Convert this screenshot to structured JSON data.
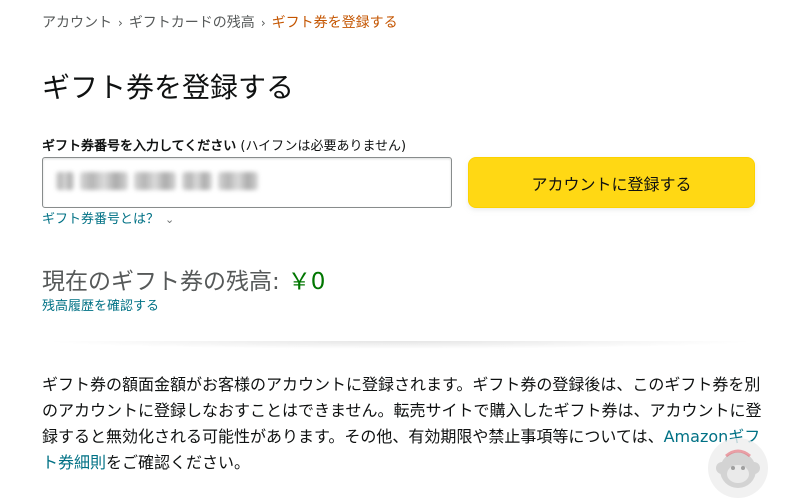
{
  "breadcrumb": {
    "items": [
      "アカウント",
      "ギフトカードの残高"
    ],
    "current": "ギフト券を登録する",
    "separator": "›"
  },
  "page": {
    "title": "ギフト券を登録する"
  },
  "form": {
    "label_bold": "ギフト券番号を入力してください",
    "label_note": "(ハイフンは必要ありません)",
    "input_value": "",
    "submit_label": "アカウントに登録する",
    "help_link": "ギフト券番号とは？",
    "help_chevron": "⌄"
  },
  "balance": {
    "label": "現在のギフト券の残高:",
    "amount": "￥0",
    "history_link": "残高履歴を確認する"
  },
  "notice": {
    "text_before": "ギフト券の額面金額がお客様のアカウントに登録されます。ギフト券の登録後は、このギフト券を別のアカウントに登録しなおすことはできません。転売サイトで購入したギフト券は、アカウントに登録すると無効化される可能性があります。その他、有効期限や禁止事項等については、",
    "link_text": "Amazonギフト券細則",
    "text_after": "をご確認ください。"
  },
  "colors": {
    "link": "#007185",
    "breadcrumb_current": "#c45500",
    "button": "#ffd814",
    "balance_amount": "#007600"
  },
  "icons": {
    "watermark": "monkey-logo-icon"
  }
}
